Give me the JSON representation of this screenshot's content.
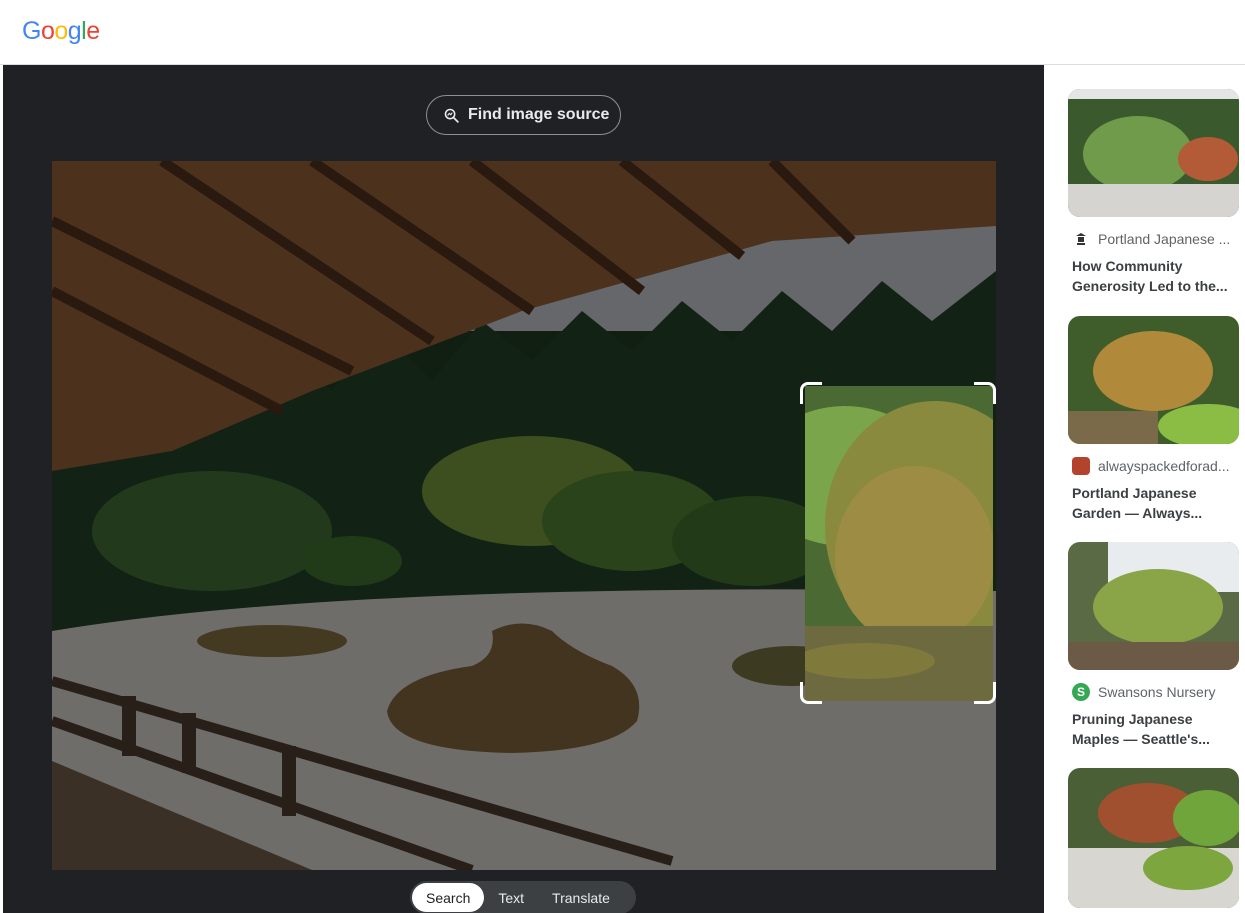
{
  "header": {
    "logo_letters": [
      {
        "ch": "G",
        "color": "#4285F4"
      },
      {
        "ch": "o",
        "color": "#EA4335"
      },
      {
        "ch": "o",
        "color": "#FBBC05"
      },
      {
        "ch": "g",
        "color": "#4285F4"
      },
      {
        "ch": "l",
        "color": "#34A853"
      },
      {
        "ch": "e",
        "color": "#EA4335"
      }
    ]
  },
  "lens": {
    "find_source_label": "Find image source",
    "find_source_icon": "image-search-icon",
    "modes": [
      {
        "label": "Search",
        "active": true
      },
      {
        "label": "Text",
        "active": false
      },
      {
        "label": "Translate",
        "active": false
      }
    ]
  },
  "results": [
    {
      "source": "Portland Japanese ...",
      "title": "How Community Generosity Led to the...",
      "favicon": "lantern-icon"
    },
    {
      "source": "alwayspackedforad...",
      "title": "Portland Japanese Garden — Always...",
      "favicon": "site-photo-icon"
    },
    {
      "source": "Swansons Nursery",
      "title": "Pruning Japanese Maples — Seattle's...",
      "favicon": "swansons-s-icon"
    },
    {
      "source": "",
      "title": "",
      "favicon": ""
    }
  ],
  "colors": {
    "panel_bg": "#202124",
    "swansons_green": "#34A853"
  }
}
